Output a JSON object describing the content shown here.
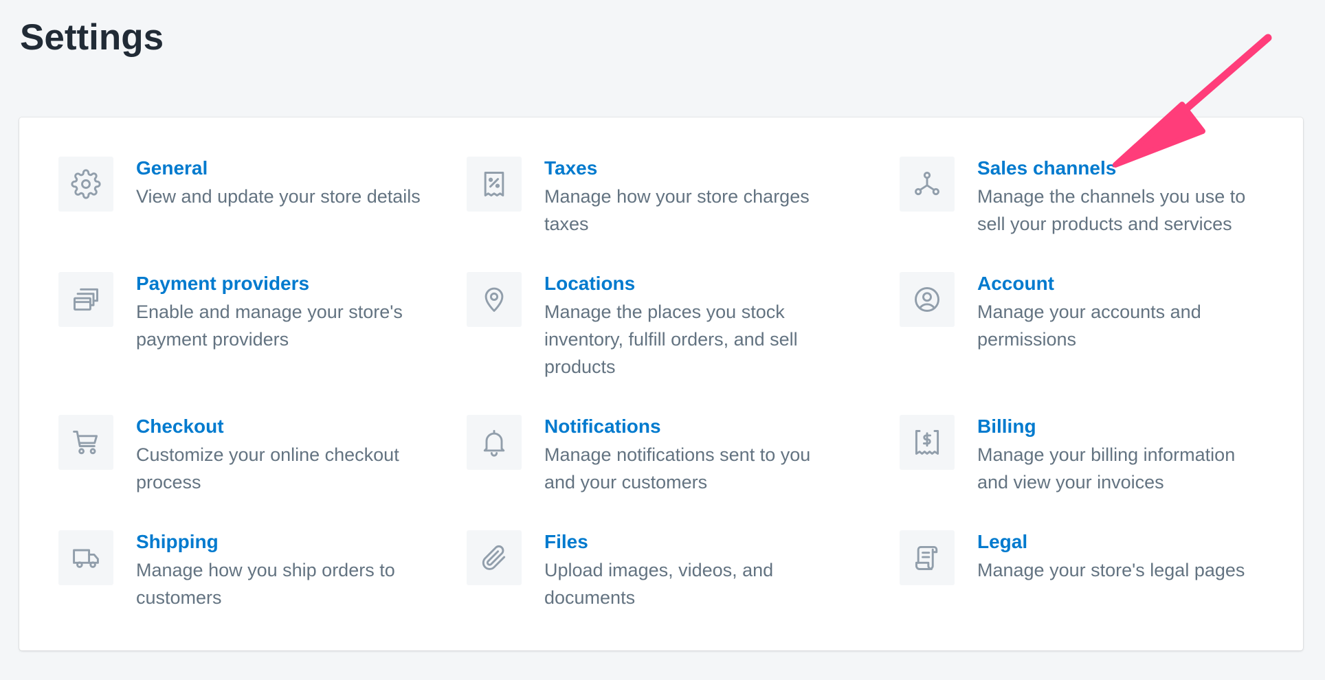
{
  "page": {
    "title": "Settings"
  },
  "settings": {
    "items": [
      {
        "id": "general",
        "title": "General",
        "description": "View and update your store details",
        "icon": "gear-icon"
      },
      {
        "id": "taxes",
        "title": "Taxes",
        "description": "Manage how your store charges taxes",
        "icon": "tax-receipt-icon"
      },
      {
        "id": "sales-channels",
        "title": "Sales channels",
        "description": "Manage the channels you use to sell your products and services",
        "icon": "channels-icon"
      },
      {
        "id": "payment-providers",
        "title": "Payment providers",
        "description": "Enable and manage your store's payment providers",
        "icon": "payment-cards-icon"
      },
      {
        "id": "locations",
        "title": "Locations",
        "description": "Manage the places you stock inventory, fulfill orders, and sell products",
        "icon": "location-pin-icon"
      },
      {
        "id": "account",
        "title": "Account",
        "description": "Manage your accounts and permissions",
        "icon": "user-circle-icon"
      },
      {
        "id": "checkout",
        "title": "Checkout",
        "description": "Customize your online checkout process",
        "icon": "cart-icon"
      },
      {
        "id": "notifications",
        "title": "Notifications",
        "description": "Manage notifications sent to you and your customers",
        "icon": "bell-icon"
      },
      {
        "id": "billing",
        "title": "Billing",
        "description": "Manage your billing information and view your invoices",
        "icon": "billing-receipt-icon"
      },
      {
        "id": "shipping",
        "title": "Shipping",
        "description": "Manage how you ship orders to customers",
        "icon": "truck-icon"
      },
      {
        "id": "files",
        "title": "Files",
        "description": "Upload images, videos, and documents",
        "icon": "paperclip-icon"
      },
      {
        "id": "legal",
        "title": "Legal",
        "description": "Manage your store's legal pages",
        "icon": "legal-document-icon"
      }
    ]
  },
  "colors": {
    "background": "#f4f6f8",
    "card": "#ffffff",
    "title_text": "#212b36",
    "link": "#007ace",
    "description": "#637381",
    "icon": "#919eab",
    "annotation_arrow": "#ff3d7a"
  }
}
